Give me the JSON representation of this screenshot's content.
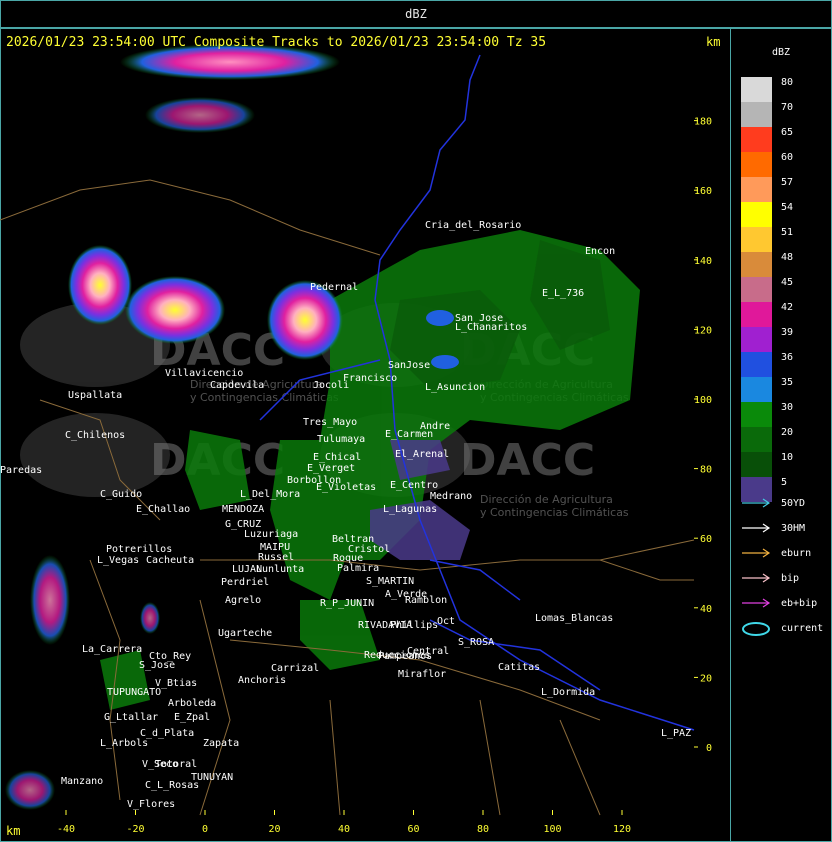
{
  "window": {
    "title": "dBZ"
  },
  "header": {
    "text": "2026/01/23 23:54:00 UTC Composite Tracks to 2026/01/23 23:54:00 Tz 35",
    "km_top": "km",
    "km_bottom": "km"
  },
  "axes": {
    "x_ticks": [
      "-40",
      "-20",
      "0",
      "20",
      "40",
      "60",
      "80",
      "100",
      "120"
    ],
    "y_ticks": [
      "180",
      "160",
      "140",
      "120",
      "100",
      "80",
      "60",
      "40",
      "20",
      "0"
    ]
  },
  "legend": {
    "title": "dBZ",
    "scale": [
      {
        "label": "80",
        "color": "#d9d9d9"
      },
      {
        "label": "70",
        "color": "#b5b5b5"
      },
      {
        "label": "65",
        "color": "#ff3c1e"
      },
      {
        "label": "60",
        "color": "#ff6a00"
      },
      {
        "label": "57",
        "color": "#ff9a5a"
      },
      {
        "label": "54",
        "color": "#ffff00"
      },
      {
        "label": "51",
        "color": "#ffc830"
      },
      {
        "label": "48",
        "color": "#d98b3a"
      },
      {
        "label": "45",
        "color": "#c86c8a"
      },
      {
        "label": "42",
        "color": "#e0189a"
      },
      {
        "label": "39",
        "color": "#a020d0"
      },
      {
        "label": "36",
        "color": "#2050e0"
      },
      {
        "label": "35",
        "color": "#1a88e0"
      },
      {
        "label": "30",
        "color": "#0a8a0a"
      },
      {
        "label": "20",
        "color": "#0a6a0a"
      },
      {
        "label": "10",
        "color": "#084f08"
      },
      {
        "label": "5",
        "color": "#4a3a8a"
      }
    ],
    "tracks": [
      {
        "label": "50YD",
        "color": "#44c8e0"
      },
      {
        "label": "30HM",
        "color": "#ffffff"
      },
      {
        "label": "eburn",
        "color": "#f0b040"
      },
      {
        "label": "bip",
        "color": "#f8c0c8"
      },
      {
        "label": "eb+bip",
        "color": "#e040e0"
      },
      {
        "label": "current",
        "color": "#40d8e8"
      }
    ]
  },
  "watermarks": {
    "brand": "DACC",
    "caption1": "Dirección de Agricultura",
    "caption2": "y Contingencias Climáticas"
  },
  "places": [
    {
      "name": "Cria_del_Rosario"
    },
    {
      "name": "Encon"
    },
    {
      "name": "E_L_736"
    },
    {
      "name": "Pedernal"
    },
    {
      "name": "San_Jose"
    },
    {
      "name": "L_Chanaritos"
    },
    {
      "name": "Villavicencio"
    },
    {
      "name": "Uspallata"
    },
    {
      "name": "C_Chilenos"
    },
    {
      "name": "Paredas"
    },
    {
      "name": "Capdevila"
    },
    {
      "name": "Jocoli"
    },
    {
      "name": "Francisco"
    },
    {
      "name": "SanJose"
    },
    {
      "name": "L_Asuncion"
    },
    {
      "name": "Tres_Mayo"
    },
    {
      "name": "Tulumaya"
    },
    {
      "name": "E_Carmen"
    },
    {
      "name": "Andre"
    },
    {
      "name": "E_Chical"
    },
    {
      "name": "E_Verget"
    },
    {
      "name": "El_Arenal"
    },
    {
      "name": "Borbollon"
    },
    {
      "name": "E_Violetas"
    },
    {
      "name": "E_Centro"
    },
    {
      "name": "C_Guido"
    },
    {
      "name": "L_Del_Mora"
    },
    {
      "name": "Medrano"
    },
    {
      "name": "E_Challao"
    },
    {
      "name": "MENDOZA"
    },
    {
      "name": "L_Lagunas"
    },
    {
      "name": "G_CRUZ"
    },
    {
      "name": "Luzuriaga"
    },
    {
      "name": "Beltran"
    },
    {
      "name": "Cristol"
    },
    {
      "name": "Potrerillos"
    },
    {
      "name": "L_Vegas"
    },
    {
      "name": "Cacheuta"
    },
    {
      "name": "MAIPU"
    },
    {
      "name": "Russel"
    },
    {
      "name": "Roque"
    },
    {
      "name": "LUJAN"
    },
    {
      "name": "Lunlunta"
    },
    {
      "name": "Palmira"
    },
    {
      "name": "S_MARTIN"
    },
    {
      "name": "Perdriel"
    },
    {
      "name": "A_Verde"
    },
    {
      "name": "Agrelo"
    },
    {
      "name": "R_P_JUNIN"
    },
    {
      "name": "Ramblon"
    },
    {
      "name": "Lomas_Blancas"
    },
    {
      "name": "Ugarteche"
    },
    {
      "name": "RIVADAVIA"
    },
    {
      "name": "Phillips"
    },
    {
      "name": "Oct"
    },
    {
      "name": "S_ROSA"
    },
    {
      "name": "La_Carrera"
    },
    {
      "name": "Cto_Rey"
    },
    {
      "name": "S_Jose"
    },
    {
      "name": "Reducciones"
    },
    {
      "name": "Pampeanos"
    },
    {
      "name": "Central"
    },
    {
      "name": "Catitas"
    },
    {
      "name": "V_Btias"
    },
    {
      "name": "Anchoris"
    },
    {
      "name": "Carrizal"
    },
    {
      "name": "TUPUNGATO"
    },
    {
      "name": "Miraflor"
    },
    {
      "name": "L_Dormida"
    },
    {
      "name": "E_Zpal"
    },
    {
      "name": "Arboleda"
    },
    {
      "name": "G_Ltallar"
    },
    {
      "name": "C_d_Plata"
    },
    {
      "name": "L_Arbols"
    },
    {
      "name": "Zapata"
    },
    {
      "name": "L_PAZ"
    },
    {
      "name": "V_Seco"
    },
    {
      "name": "Totoral"
    },
    {
      "name": "TUNUYAN"
    },
    {
      "name": "Manzano"
    },
    {
      "name": "C_L_Rosas"
    },
    {
      "name": "V_Flores"
    }
  ]
}
